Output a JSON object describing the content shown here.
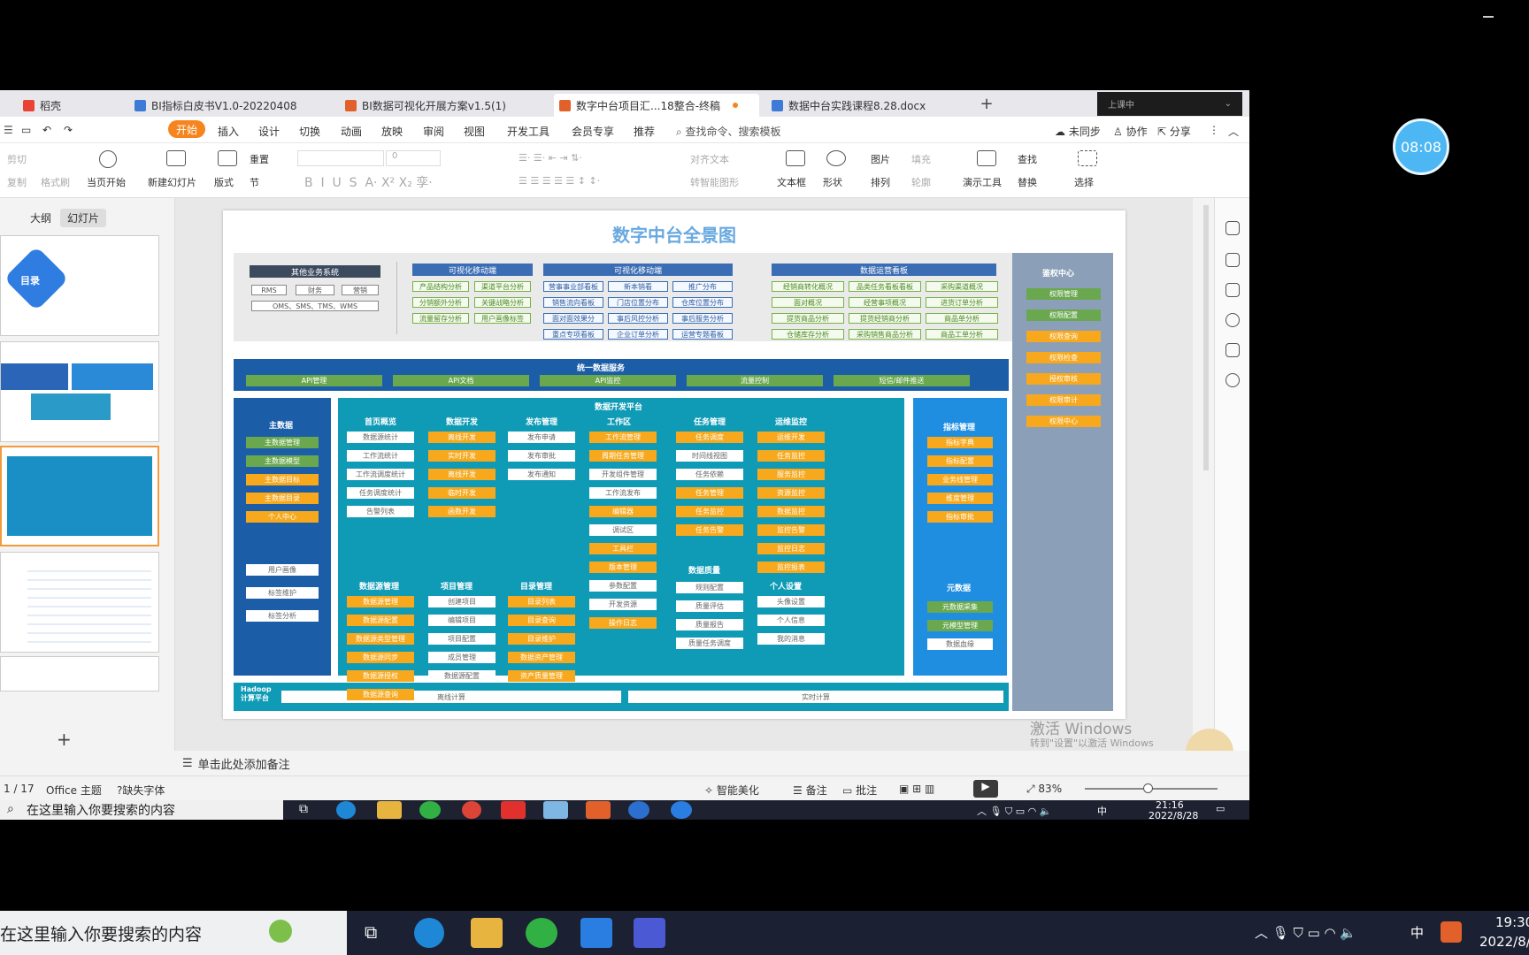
{
  "timer": "08:08",
  "tabs": [
    {
      "label": "稻壳",
      "color": "#e94335"
    },
    {
      "label": "BI指标白皮书V1.0-20220408",
      "color": "#3e7bd6"
    },
    {
      "label": "BI数据可视化开展方案v1.5(1)",
      "color": "#e2612b"
    },
    {
      "label": "数字中台项目汇...18整合-终稿",
      "color": "#e2612b"
    },
    {
      "label": "数据中台实践课程8.28.docx",
      "color": "#3e7bd6"
    }
  ],
  "recording": {
    "label": "上课中"
  },
  "menu": {
    "start": "开始",
    "items": [
      "插入",
      "设计",
      "切换",
      "动画",
      "放映",
      "审阅",
      "视图",
      "开发工具",
      "会员专享",
      "推荐"
    ],
    "search": "查找命令、搜索模板",
    "sync": "未同步",
    "collab": "协作",
    "share": "分享"
  },
  "toolbar": {
    "cut": "剪切",
    "copy": "复制",
    "format_painter": "格式刷",
    "play_current": "当页开始",
    "new_slide": "新建幻灯片",
    "layout": "版式",
    "section": "节",
    "reset": "重置",
    "font_size": "0",
    "align_text": "对齐文本",
    "smartart": "转智能图形",
    "textbox": "文本框",
    "shape": "形状",
    "picture": "图片",
    "fill": "填充",
    "arrange": "排列",
    "outline": "轮廓",
    "present_tools": "演示工具",
    "find": "查找",
    "replace": "替换",
    "select": "选择"
  },
  "left_pane": {
    "tab_outline": "大纲",
    "tab_slides": "幻灯片",
    "thumb1_title": "目录"
  },
  "notes_placeholder": "单击此处添加备注",
  "status": {
    "page": "1 / 17",
    "theme": "Office 主题",
    "missing_font": "缺失字体",
    "beautify": "智能美化",
    "notes": "备注",
    "comments": "批注",
    "zoom": "83%"
  },
  "watermark": {
    "line1": "激活 Windows",
    "line2": "转到\"设置\"以激活 Windows"
  },
  "inner_taskbar": {
    "search": "在这里输入你要搜索的内容",
    "time": "21:16",
    "date": "2022/8/28",
    "ime": "中"
  },
  "outer_taskbar": {
    "search": "在这里输入你要搜索的内容",
    "time": "19:30",
    "date": "2022/8/",
    "ime": "中"
  },
  "slide": {
    "title": "数字中台全景图",
    "top_groups": [
      {
        "head": "其他业务系统",
        "color": "#3c4a5e"
      },
      {
        "head": "可视化移动端",
        "color": "#3b6db5"
      },
      {
        "head": "可视化移动端",
        "color": "#3b6db5"
      },
      {
        "head": "数据运营看板",
        "color": "#3b6db5"
      }
    ],
    "other_systems": [
      "RMS",
      "财务",
      "营销",
      "OMS、SMS、TMS、WMS"
    ],
    "mobile1": [
      "产品结构分析",
      "渠道平台分析",
      "分销额外分析",
      "关键战略分析",
      "流量留存分析",
      "用户画像标签"
    ],
    "mobile2": [
      "营事事业部看板",
      "新本销看",
      "推广分布",
      "销售流向看板",
      "门店位置分布",
      "仓库位置分布",
      "面对面效果分",
      "事后风控分析",
      "事后服务分析",
      "重点专项看板",
      "企业订单分析",
      "运营专题看板"
    ],
    "ops_board": [
      "经销商转化概况",
      "品类任务看板看板",
      "采购渠道概况",
      "面对概况",
      "经营事项概况",
      "进货订单分析",
      "提货商品分析",
      "提货经销商分析",
      "商品单分析",
      "仓储库存分析",
      "采购销售商品分析",
      "商品工单分析"
    ],
    "auth": {
      "title": "鉴权中心",
      "items": [
        "权限管理",
        "权限配置",
        "权限查询",
        "权限检查",
        "授权审核",
        "权限审计",
        "权限中心"
      ]
    },
    "unified": {
      "title": "统一数据服务",
      "items": [
        "API管理",
        "API文档",
        "API监控",
        "流量控制",
        "短信/邮件推送"
      ]
    },
    "master": {
      "title": "主数据",
      "items": [
        "主数据管理",
        "主数据模型",
        "主数据目标",
        "主数据目录",
        "个人中心",
        "用户画像",
        "标签维护",
        "标签分析"
      ]
    },
    "platform": {
      "title": "数据开发平台",
      "cols": [
        {
          "title": "首页概览",
          "items": [
            "数据源统计",
            "工作流统计",
            "工作流调度统计",
            "任务调度统计",
            "告警列表"
          ]
        },
        {
          "title": "数据开发",
          "items": [
            "离线开发",
            "实时开发",
            "离线开发",
            "临时开发",
            "函数开发"
          ]
        },
        {
          "title": "发布管理",
          "items": [
            "发布申请",
            "发布审批",
            "发布通知"
          ]
        },
        {
          "title": "工作区",
          "items": [
            "工作流管理",
            "周期任务管理",
            "开发组件管理",
            "工作流发布",
            "编辑器",
            "调试区",
            "工具栏",
            "版本管理",
            "参数配置",
            "开发资源",
            "操作日志"
          ]
        },
        {
          "title": "任务管理",
          "items": [
            "任务调度",
            "时间线视图",
            "任务依赖",
            "任务管理",
            "任务监控",
            "任务告警"
          ]
        },
        {
          "title": "运维监控",
          "items": [
            "运维开发",
            "任务监控",
            "服务监控",
            "资源监控",
            "数据监控",
            "监控告警",
            "监控日志",
            "监控报表"
          ]
        }
      ],
      "lower": [
        {
          "title": "数据源管理",
          "items": [
            "数据源管理",
            "数据源配置",
            "数据源类型管理",
            "数据源同步",
            "数据源授权",
            "数据源查询"
          ]
        },
        {
          "title": "项目管理",
          "items": [
            "创建项目",
            "编辑项目",
            "项目配置",
            "成员管理",
            "数据源配置"
          ]
        },
        {
          "title": "目录管理",
          "items": [
            "目录列表",
            "目录查询",
            "目录维护",
            "数据资产管理",
            "资产质量管理"
          ]
        },
        {
          "title": "数据质量",
          "items": [
            "规则配置",
            "质量评估",
            "质量报告",
            "质量任务调度"
          ]
        },
        {
          "title": "个人设置",
          "items": [
            "头像设置",
            "个人信息",
            "我的消息"
          ]
        }
      ]
    },
    "metrics": {
      "title": "指标管理",
      "items": [
        "指标字典",
        "指标配置",
        "业务线管理",
        "维度管理",
        "指标审批"
      ]
    },
    "metadata": {
      "title": "元数据",
      "items": [
        "元数据采集",
        "元模型管理",
        "数据血缘"
      ]
    },
    "hadoop": {
      "title": "Hadoop\n计算平台",
      "offline": "离线计算",
      "realtime": "实时计算"
    }
  }
}
